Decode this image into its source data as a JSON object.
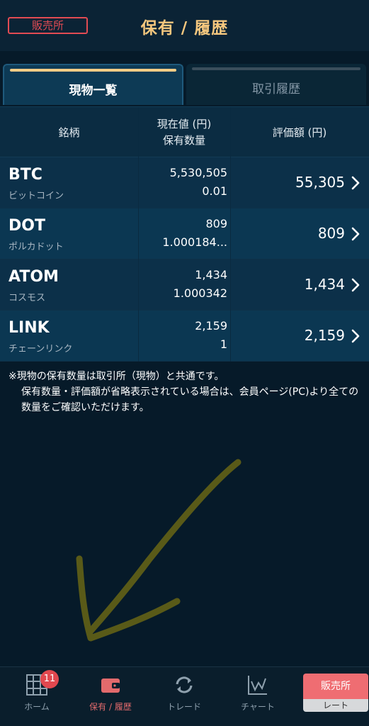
{
  "header": {
    "exchange_badge": "販売所",
    "title": "保有 / 履歴"
  },
  "tabs": [
    {
      "label": "現物一覧",
      "active": true
    },
    {
      "label": "取引履歴",
      "active": false
    }
  ],
  "table": {
    "headers": {
      "name": "銘柄",
      "price": "現在値 (円)",
      "qty": "保有数量",
      "value": "評価額 (円)"
    },
    "rows": [
      {
        "symbol": "BTC",
        "name": "ビットコイン",
        "price": "5,530,505",
        "qty": "0.01",
        "value": "55,305"
      },
      {
        "symbol": "DOT",
        "name": "ポルカドット",
        "price": "809",
        "qty": "1.000184...",
        "value": "809"
      },
      {
        "symbol": "ATOM",
        "name": "コスモス",
        "price": "1,434",
        "qty": "1.000342",
        "value": "1,434"
      },
      {
        "symbol": "LINK",
        "name": "チェーンリンク",
        "price": "2,159",
        "qty": "1",
        "value": "2,159"
      }
    ]
  },
  "note": {
    "line1": "※現物の保有数量は取引所（現物）と共通です。",
    "line2": "保有数量・評価額が省略表示されている場合は、会員ページ(PC)より全ての数量をご確認いただけます。"
  },
  "tabbar": {
    "items": [
      {
        "label": "ホーム",
        "icon": "grid-icon",
        "badge": "11"
      },
      {
        "label": "保有 / 履歴",
        "icon": "wallet-icon",
        "active": true
      },
      {
        "label": "トレード",
        "icon": "refresh-icon"
      },
      {
        "label": "チャート",
        "icon": "chart-icon"
      }
    ],
    "rate_button": {
      "top": "販売所",
      "bottom": "レート"
    }
  },
  "colors": {
    "accent_gold": "#f5c77e",
    "accent_red": "#e24b53",
    "background": "#061a29"
  }
}
